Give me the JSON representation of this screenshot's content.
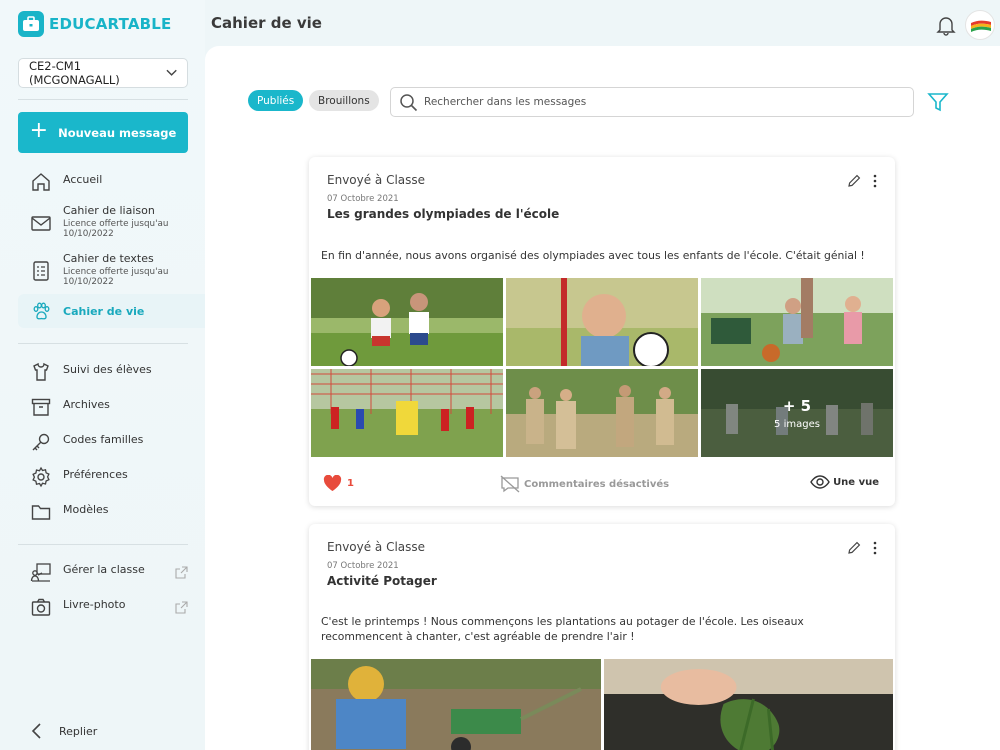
{
  "brand": {
    "prefix": "EDU",
    "suffix": "CARTABLE"
  },
  "header": {
    "title": "Cahier de vie"
  },
  "sidebar": {
    "class_select": "CE2-CM1 (MCGONAGALL)",
    "new_message": "Nouveau message",
    "items": [
      {
        "label": "Accueil",
        "icon": "home-icon"
      },
      {
        "label": "Cahier de liaison",
        "sub": "Licence offerte jusqu'au 10/10/2022",
        "icon": "envelope-icon"
      },
      {
        "label": "Cahier de textes",
        "sub": "Licence offerte jusqu'au 10/10/2022",
        "icon": "checklist-icon"
      },
      {
        "label": "Cahier de vie",
        "icon": "paw-icon",
        "active": true
      },
      {
        "label": "Suivi des élèves",
        "icon": "shirt-icon"
      },
      {
        "label": "Archives",
        "icon": "archive-icon"
      },
      {
        "label": "Codes familles",
        "icon": "key-icon"
      },
      {
        "label": "Préférences",
        "icon": "gear-icon"
      },
      {
        "label": "Modèles",
        "icon": "folder-icon"
      },
      {
        "label": "Gérer la classe",
        "icon": "classroom-icon",
        "external": true
      },
      {
        "label": "Livre-photo",
        "icon": "camera-icon",
        "external": true
      }
    ],
    "collapse": "Replier"
  },
  "toolbar": {
    "tab_published": "Publiés",
    "tab_drafts": "Brouillons",
    "search_placeholder": "Rechercher dans les messages"
  },
  "posts": [
    {
      "sender": "Envoyé à Classe",
      "date": "07 Octobre 2021",
      "title": "Les grandes olympiades de l'école",
      "body": "En fin d'année, nous avons organisé des olympiades avec tous les enfants de l'école. C'était génial !",
      "more_count": "+ 5",
      "more_label": "5 images",
      "likes": "1",
      "comments": "Commentaires désactivés",
      "views": "Une vue"
    },
    {
      "sender": "Envoyé à Classe",
      "date": "07 Octobre 2021",
      "title": "Activité Potager",
      "body": "C'est le printemps ! Nous commençons les plantations au potager de l'école. Les oiseaux recommencent à chanter, c'est agréable de prendre l'air !"
    }
  ],
  "colors": {
    "accent": "#1ab7cb",
    "like": "#e84b3c"
  }
}
